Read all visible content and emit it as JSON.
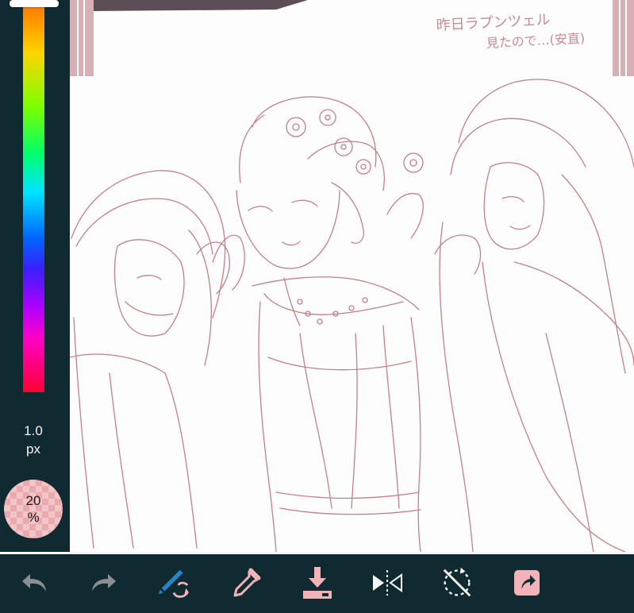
{
  "sidebar": {
    "brush_size_value": "1.0",
    "brush_size_unit": "px",
    "opacity_value": "20",
    "opacity_unit": "%"
  },
  "canvas": {
    "note_line1": "昨日ラプンツェル",
    "note_line2": "見たので…(安直)",
    "line_color": "#c27f89"
  },
  "toolbar": {
    "icons": [
      "undo-icon",
      "redo-icon",
      "brush-swap-icon",
      "eyedropper-icon",
      "save-icon",
      "flip-icon",
      "rotate-reset-icon",
      "share-icon"
    ]
  },
  "colors": {
    "panel": "#0f2a30",
    "accent_pink": "#f1c6c9",
    "disabled_icon": "#8a8f91",
    "active_icon": "#f2b3b8",
    "brush_icon_blue": "#2a83c7"
  }
}
